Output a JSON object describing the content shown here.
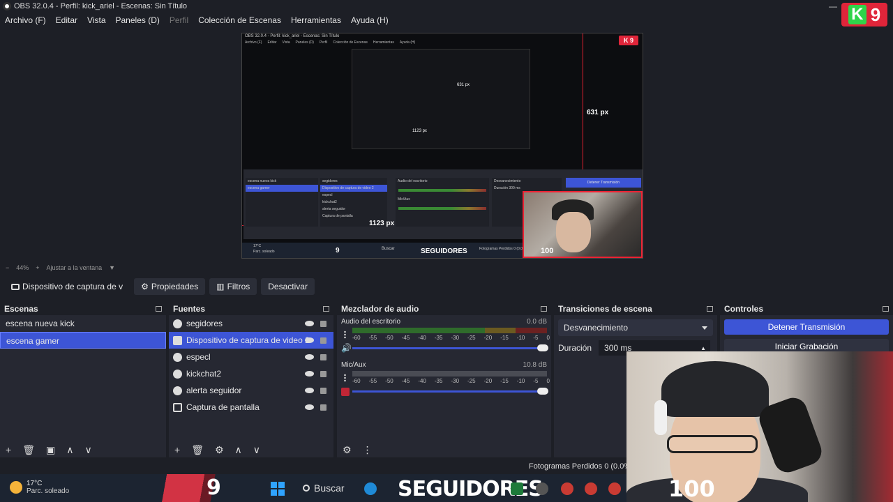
{
  "window": {
    "title": "OBS 32.0.4 - Perfil: kick_ariel - Escenas: Sin Título",
    "minimize": "—",
    "restore": "❐"
  },
  "menu": [
    "Archivo (F)",
    "Editar",
    "Vista",
    "Paneles (D)",
    "Perfil",
    "Colección de Escenas",
    "Herramientas",
    "Ayuda (H)"
  ],
  "overlay": {
    "kick_letter": "K",
    "kick_number": "9",
    "px_width": "1123 px",
    "px_height": "631 px",
    "nested_px_height": "631 px",
    "nested_px_width": "1123 px"
  },
  "preview_inner": {
    "title": "OBS 32.0.4 - Perfil: kick_ariel - Escenas: Sin Título",
    "menu": [
      "Archivo (F)",
      "Editar",
      "Vista",
      "Paneles (D)",
      "Perfil",
      "Colección de Escenas",
      "Herramientas",
      "Ayuda (H)"
    ],
    "scenes": [
      "escena nueva kick",
      "escena gamer"
    ],
    "sources": [
      "segidores",
      "Dispositivo de captura de video 2",
      "especl",
      "kickchat2",
      "alerta seguidor",
      "Captura de pantalla"
    ],
    "mixer_ch1": "Audio del escritorio",
    "mixer_ch2": "Mic/Aux",
    "trans": "Desvanecimiento",
    "duration": "Duración",
    "duration_val": "300 ms",
    "stop": "Detener Transmisión",
    "stats": "Fotogramas Perdidos 0 (0,0%)",
    "seguidores": "SEGUIDORES",
    "hundred": "100",
    "nine": "9",
    "buscar": "Buscar",
    "weather": "17°C",
    "weather_cond": "Parc. soleado"
  },
  "zoom": {
    "minus": "−",
    "value": "44%",
    "plus": "+",
    "fit": "Ajustar a la ventana"
  },
  "source_toolbar": {
    "source_name": "Dispositivo de captura de v",
    "properties": "Propiedades",
    "filters": "Filtros",
    "deactivate": "Desactivar"
  },
  "scenes_dock": {
    "title": "Escenas",
    "items": [
      "escena nueva kick",
      "escena gamer"
    ],
    "selected_index": 1
  },
  "sources_dock": {
    "title": "Fuentes",
    "items": [
      {
        "name": "segidores",
        "icon": "globe-icon"
      },
      {
        "name": "Dispositivo de captura de video 2",
        "icon": "camera-icon"
      },
      {
        "name": "especl",
        "icon": "globe-icon"
      },
      {
        "name": "kickchat2",
        "icon": "globe-icon"
      },
      {
        "name": "alerta seguidor",
        "icon": "globe-icon"
      },
      {
        "name": "Captura de pantalla",
        "icon": "monitor-icon"
      }
    ],
    "selected_index": 1
  },
  "mixer_dock": {
    "title": "Mezclador de audio",
    "channels": [
      {
        "name": "Audio del escritorio",
        "db": "0.0 dB",
        "muted": false
      },
      {
        "name": "Mic/Aux",
        "db": "10.8 dB",
        "muted": true
      }
    ],
    "ticks": [
      "-60",
      "-55",
      "-50",
      "-45",
      "-40",
      "-35",
      "-30",
      "-25",
      "-20",
      "-15",
      "-10",
      "-5",
      "0"
    ]
  },
  "transitions_dock": {
    "title": "Transiciones de escena",
    "selected": "Desvanecimiento",
    "duration_label": "Duración",
    "duration_value": "300 ms"
  },
  "controls_dock": {
    "title": "Controles",
    "stop_stream": "Detener Transmisión",
    "start_record": "Iniciar Grabación"
  },
  "status": {
    "frames": "Fotogramas Perdidos 0 (0.0%"
  },
  "taskbar": {
    "temperature": "17°C",
    "condition": "Parc. soleado",
    "nine": "9",
    "search": "Buscar",
    "seguidores": "SEGUIDORES",
    "hundred": "100"
  },
  "colors": {
    "accent": "#3d55d6",
    "background": "#1d1f26",
    "dock": "#262832",
    "kick_green": "#2fd44a",
    "kick_red": "#e0253a"
  }
}
